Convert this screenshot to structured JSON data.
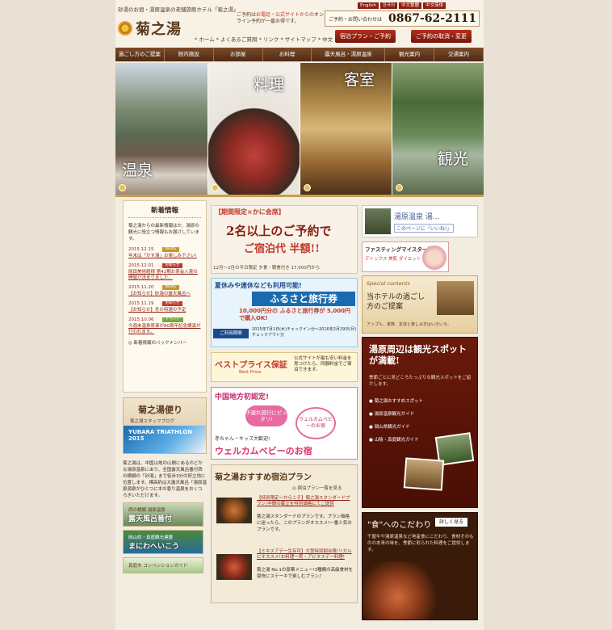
{
  "header": {
    "tagline": "砂湯のお宿・湯原温泉の老舗旅館ホテル「菊之湯」",
    "logo_text": "菊之湯",
    "notice_pre": "ご予約は",
    "notice_mid": "お電話・公式サイトからの",
    "notice_end": "オンライン予約が一番お得です。",
    "phone_label": "ご予約・お問い合わせは",
    "phone_number": "0867-62-2111",
    "languages": [
      "English",
      "한국어",
      "中文繁體",
      "中文简体"
    ],
    "nav": "* ホーム * よくあるご質問 * リンク * サイトマップ * 中文",
    "btn_plan": "宿泊プラン・ご予約",
    "btn_cancel": "ご予約の取消・変更"
  },
  "menu": [
    "過ごし方のご提案",
    "館内施設",
    "お部屋",
    "お料理",
    "露天風呂・湯原温泉",
    "観光案内",
    "交通案内"
  ],
  "hero": [
    "温泉",
    "料理",
    "客室",
    "観光"
  ],
  "news": {
    "heading": "新着情報",
    "intro": "菊之湯からの最新情報はか、湯原の観光に役立つ情報もお届けしています。",
    "items": [
      {
        "date": "2015.12.15",
        "tag": "NEWS",
        "title": "年末は「かす湯」お楽しみ下さい!"
      },
      {
        "date": "2015.12.01",
        "tag": "お知らせ",
        "title": "岡田美術館様 第42期お茶会入賞の開催が決まりました。"
      },
      {
        "date": "2015.11.20",
        "tag": "NEWS",
        "title": "【お知らせ】砂湯の露天風呂へ"
      },
      {
        "date": "2015.11.19",
        "tag": "お知らせ",
        "title": "【お知らせ】冬の特選の予定"
      },
      {
        "date": "2015.10.06",
        "tag": "イベント",
        "title": "今週末温泉祭事が80周年記念講演が行われます。"
      }
    ],
    "back_link": "◎ 新着情報のバックナンバー"
  },
  "blog": {
    "title": "菊之湯便り",
    "subtitle": "菊之湯スタッフブログ",
    "triathlon": "YUBARA TRIATHLON 2015"
  },
  "about": "菊之湯は、中国山地の山間にあるのどかな湯原温泉にあり、全国露天風呂番付西の横綱の「砂湯」まで徒歩3分の好立地に位置します。標高約は大露天風呂「湯原温泉源泉がひとつに木の香り温泉をおくつろぎいただけます。",
  "left_banners": [
    {
      "a": "西の横綱 湯原温泉",
      "b": "露天風呂番付"
    },
    {
      "a": "岡山県・真庭観光連盟",
      "b": "まにわへいこう"
    },
    {
      "a": "真庭市 コンベンションガイド",
      "b": ""
    }
  ],
  "mid": {
    "b1_top": "【期間限定×かに会席】",
    "b1_main": "2名以上のご予約で",
    "b1_sub": "ご宿泊代 半額!!",
    "b1_foot": "12月～2月の平日限定 夕食・朝食付き 17,000円から",
    "b2_top": "夏休みや連休なども利用可能!",
    "b2_main": "ふるさと旅行券",
    "b2_sub": "10,000円分の ふるさと旅行券が 5,000円で購入OK!",
    "b2_use": "ご利用期間",
    "b2_period": "2015年7月1日(水)チェックイン分～2016年2月29日(月)チェックアウト分",
    "b3_main": "ベストプライス保証",
    "b3_en": "Best Price",
    "b3_text": "公式サイトが最も安い料金を見つけたら、同額料金でご宿泊できます。",
    "b4_top": "中国地方初認定!",
    "b4_badge": "子連れ旅行にピッタリ!",
    "b4_small": "ウェルカムベビーのお宿",
    "b4_kids": "赤ちゃん・キッズ大歓迎!",
    "b4_main": "ウェルカムベビーのお宿",
    "plans_title": "菊之湯おすすめ宿泊プラン",
    "plans_more": "◎ 宿泊プラン一覧を見る",
    "plans": [
      {
        "title": "【特別限定～からこそ】菊之湯スタンダードプラン!中間の献立を特別価格にてご提供",
        "desc": "菊之湯スタンダードのプランです。プラン価格に迷ったら、このプランがオススメ!一番人気のプランです。"
      },
      {
        "title": "【ミキスアデー生存可】大型特別割合限!リカルにオススメ!お料理一貫・アピタスデー料理!",
        "desc": "菊之湯 No.1の豪華メニュー!3種類の高級食材を豪快にステーキで楽しむプラン♪"
      }
    ]
  },
  "right": {
    "fb_title": "湯原温泉 湯...",
    "fb_like": "このページに「いいね!」",
    "fasting": "ファスティングマイスター認定",
    "fasting_sub": "デトックス 美肌 ダイエット",
    "spec_en": "Special contents",
    "spec_title": "当ホテルの過ごし方のご提案",
    "spec_sub": "アップル、家族、友達と楽しみ方はいろいろ。",
    "sights_title": "湯原周辺は観光スポットが満載!",
    "sights_text": "季節ごとに見どころたっぷりな観光スポットをご紹介します。",
    "sights_links": [
      "菊之湯おすすめスポット",
      "湯原温泉観光ガイド",
      "岡山県観光ガイド",
      "山陰・真庭観光ガイド"
    ],
    "food_title": "\"食\"へのこだわり",
    "food_btn": "詳しく見る",
    "food_text": "千屋牛や湯原温泉など地産食にこだわり、食材そのものの本来の味を、季節に彩られた料理をご提供します。"
  },
  "colors": {
    "brown": "#5a3a1a",
    "red": "#8a1f12",
    "gold": "#c7a04c",
    "cream": "#f3ece0"
  }
}
